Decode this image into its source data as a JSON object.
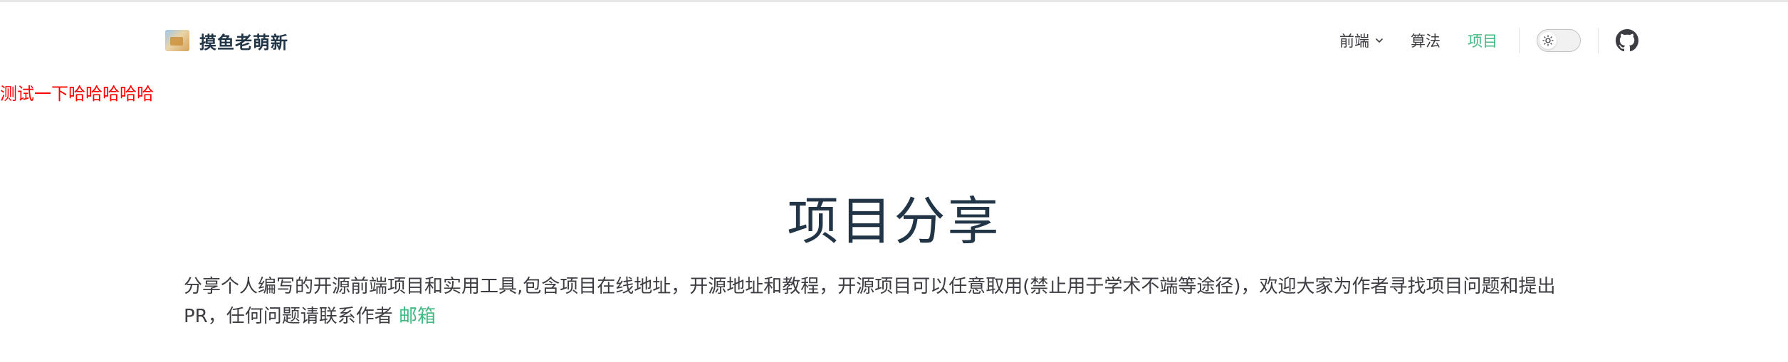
{
  "brand": {
    "name": "摸鱼老萌新",
    "logo_icon": "site-logo"
  },
  "nav": {
    "items": [
      {
        "label": "前端",
        "has_dropdown": true,
        "active": false
      },
      {
        "label": "算法",
        "has_dropdown": false,
        "active": false
      },
      {
        "label": "项目",
        "has_dropdown": false,
        "active": true
      }
    ],
    "theme_toggle": {
      "icon": "sun-icon",
      "state": "light"
    },
    "social": {
      "icon": "github-icon"
    }
  },
  "test_banner": "测试一下哈哈哈哈哈",
  "page": {
    "title": "项目分享",
    "description_line1": "分享个人编写的开源前端项目和实用工具,包含项目在线地址，开源地址和教程，开源项目可以任意取用(禁止用于学术不端等途径)，欢迎大家为作者寻找项目问题和提出",
    "description_line2": "PR，任何问题请联系作者 ",
    "email_link": "邮箱"
  },
  "colors": {
    "accent": "#42b883",
    "text": "#213547",
    "test_banner": "#ff0000"
  }
}
